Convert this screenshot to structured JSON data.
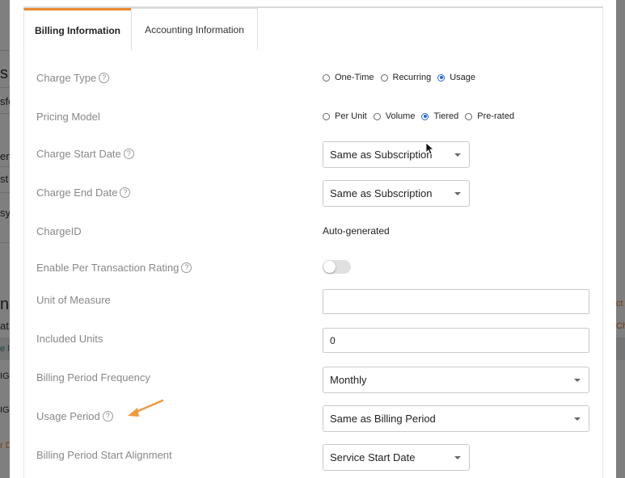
{
  "background": {
    "fragments": [
      "s",
      "sfo",
      "eri",
      "st",
      "sy",
      "n",
      "at",
      "e l",
      "IG",
      "IG",
      "r D",
      "ct",
      "Ch"
    ]
  },
  "tabs": [
    {
      "label": "Billing Information",
      "active": true
    },
    {
      "label": "Accounting Information",
      "active": false
    }
  ],
  "form": {
    "charge_type": {
      "label": "Charge Type",
      "options": [
        "One-Time",
        "Recurring",
        "Usage"
      ],
      "selected": "Usage"
    },
    "pricing_model": {
      "label": "Pricing Model",
      "options": [
        "Per Unit",
        "Volume",
        "Tiered",
        "Pre-rated"
      ],
      "selected": "Tiered"
    },
    "charge_start_date": {
      "label": "Charge Start Date",
      "value": "Same as Subscription"
    },
    "charge_end_date": {
      "label": "Charge End Date",
      "value": "Same as Subscription"
    },
    "charge_id": {
      "label": "ChargeID",
      "value": "Auto-generated"
    },
    "per_transaction_rating": {
      "label": "Enable Per Transaction Rating",
      "enabled": false
    },
    "unit_of_measure": {
      "label": "Unit of Measure",
      "value": ""
    },
    "included_units": {
      "label": "Included Units",
      "value": "0"
    },
    "billing_period_frequency": {
      "label": "Billing Period Frequency",
      "value": "Monthly"
    },
    "usage_period": {
      "label": "Usage Period",
      "value": "Same as Billing Period"
    },
    "billing_period_start_alignment": {
      "label": "Billing Period Start Alignment",
      "value": "Service Start Date"
    }
  },
  "colors": {
    "accent_tab": "#e98a2f",
    "annotation_arrow": "#ef9a3c",
    "radio_checked": "#2468d8"
  },
  "help_icon": "?"
}
